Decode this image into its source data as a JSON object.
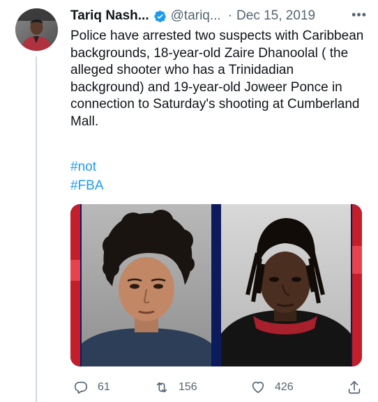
{
  "tweet": {
    "author_name": "Tariq Nash...",
    "handle": "@tariq...",
    "separator": "·",
    "date": "Dec 15, 2019",
    "more_icon": "more-horizontal-icon",
    "verified_icon": "verified-badge-icon",
    "text": "Police have arrested two suspects with Caribbean backgrounds, 18-year-old Zaire Dhanoolal ( the alleged shooter who has a Trinidadian background) and 19-year-old Joweer Ponce in connection to Saturday's shooting at Cumberland Mall.",
    "hashtags": [
      "#not",
      "#FBA"
    ]
  },
  "actions": {
    "replies": "61",
    "retweets": "156",
    "likes": "426",
    "reply_icon": "reply-icon",
    "retweet_icon": "retweet-icon",
    "like_icon": "heart-icon",
    "share_icon": "share-icon"
  },
  "colors": {
    "link": "#1d9bf0",
    "secondary": "#536471",
    "verified": "#1d9bf0"
  }
}
